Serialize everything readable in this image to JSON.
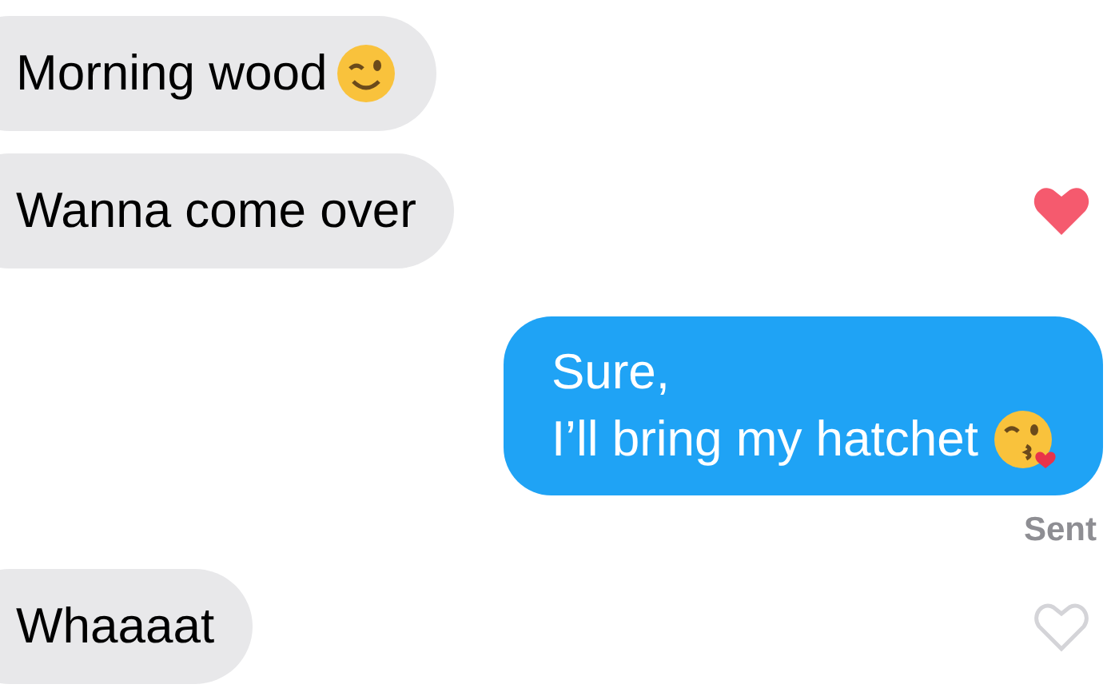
{
  "messages": [
    {
      "kind": "incoming",
      "lines": [
        "Morning wood"
      ],
      "emoji": true
    },
    {
      "kind": "incoming",
      "lines": [
        "Wanna come over"
      ],
      "liked": true
    },
    {
      "kind": "outgoing",
      "lines": [
        "Sure,",
        "I’ll bring my hatchet"
      ],
      "emoji": true,
      "status": "Sent"
    },
    {
      "kind": "incoming",
      "lines": [
        "Whaaaat"
      ],
      "liked": false
    }
  ]
}
